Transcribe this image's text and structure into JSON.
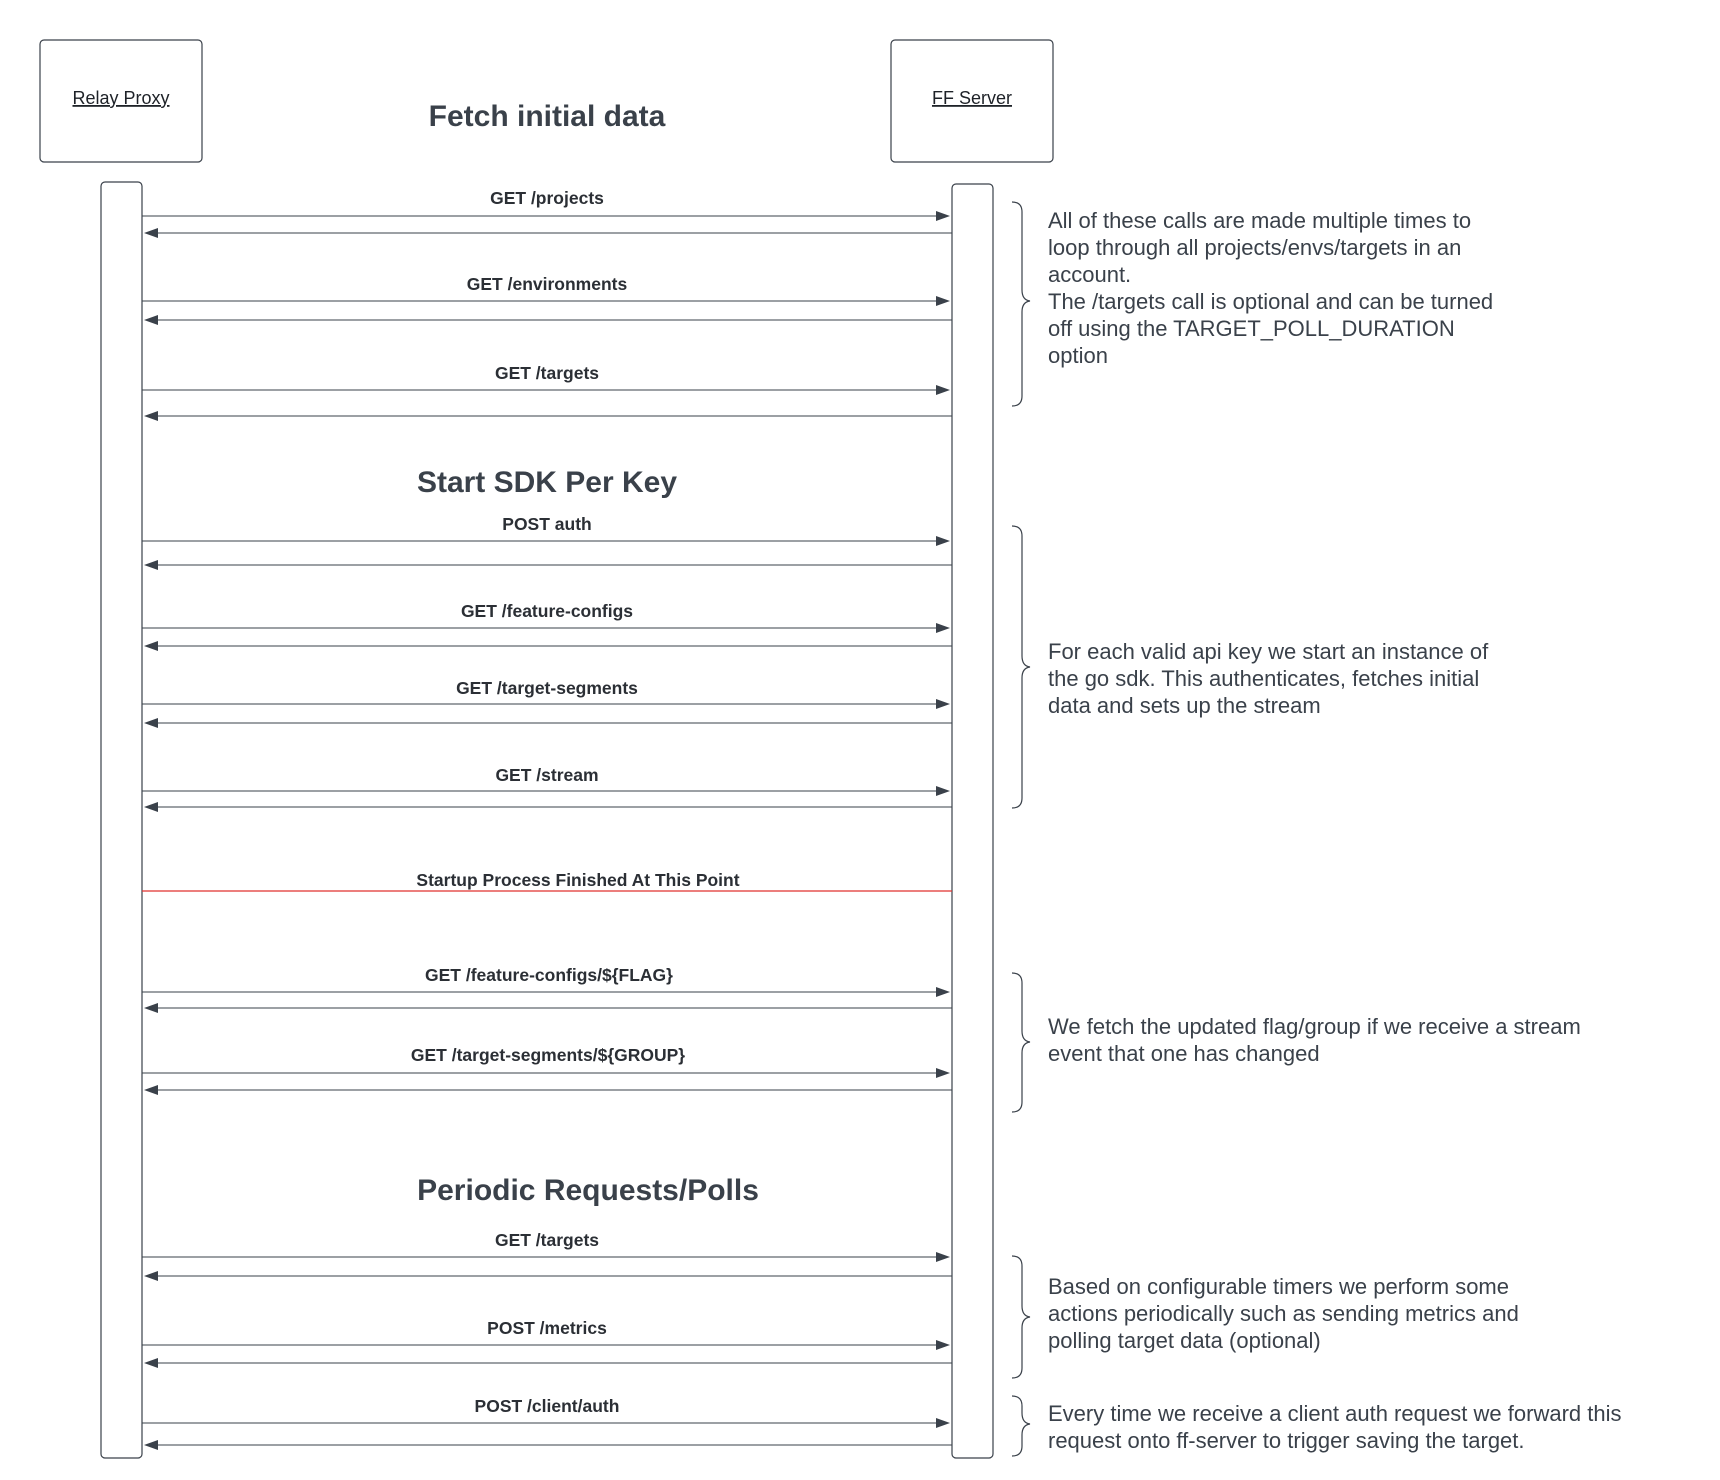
{
  "actors": {
    "relay_proxy": "Relay Proxy",
    "ff_server": "FF Server"
  },
  "sections": {
    "fetch_initial": "Fetch initial data",
    "start_sdk": "Start SDK Per Key",
    "periodic": "Periodic Requests/Polls"
  },
  "messages": [
    "GET /projects",
    "GET /environments",
    "GET /targets",
    "POST auth",
    "GET /feature-configs",
    "GET /target-segments",
    "GET /stream",
    "GET /feature-configs/${FLAG}",
    "GET /target-segments/${GROUP}",
    "GET /targets",
    "POST /metrics",
    "POST /client/auth"
  ],
  "divider": "Startup Process Finished At This Point",
  "notes": [
    [
      "All of these calls are made multiple times to",
      "loop through all projects/envs/targets in an",
      "account.",
      "The /targets call is optional and can be turned",
      "off using the TARGET_POLL_DURATION",
      "option"
    ],
    [
      "For each valid api key we start an instance of",
      "the go sdk. This authenticates, fetches initial",
      "data and sets up the stream"
    ],
    [
      "We fetch the updated flag/group if we receive a stream",
      "event that one has changed"
    ],
    [
      "Based on configurable timers we perform some",
      "actions periodically such as sending metrics and",
      "polling target data (optional)"
    ],
    [
      "Every time we receive a client auth request we forward this",
      "request onto ff-server to trigger saving the target."
    ]
  ]
}
